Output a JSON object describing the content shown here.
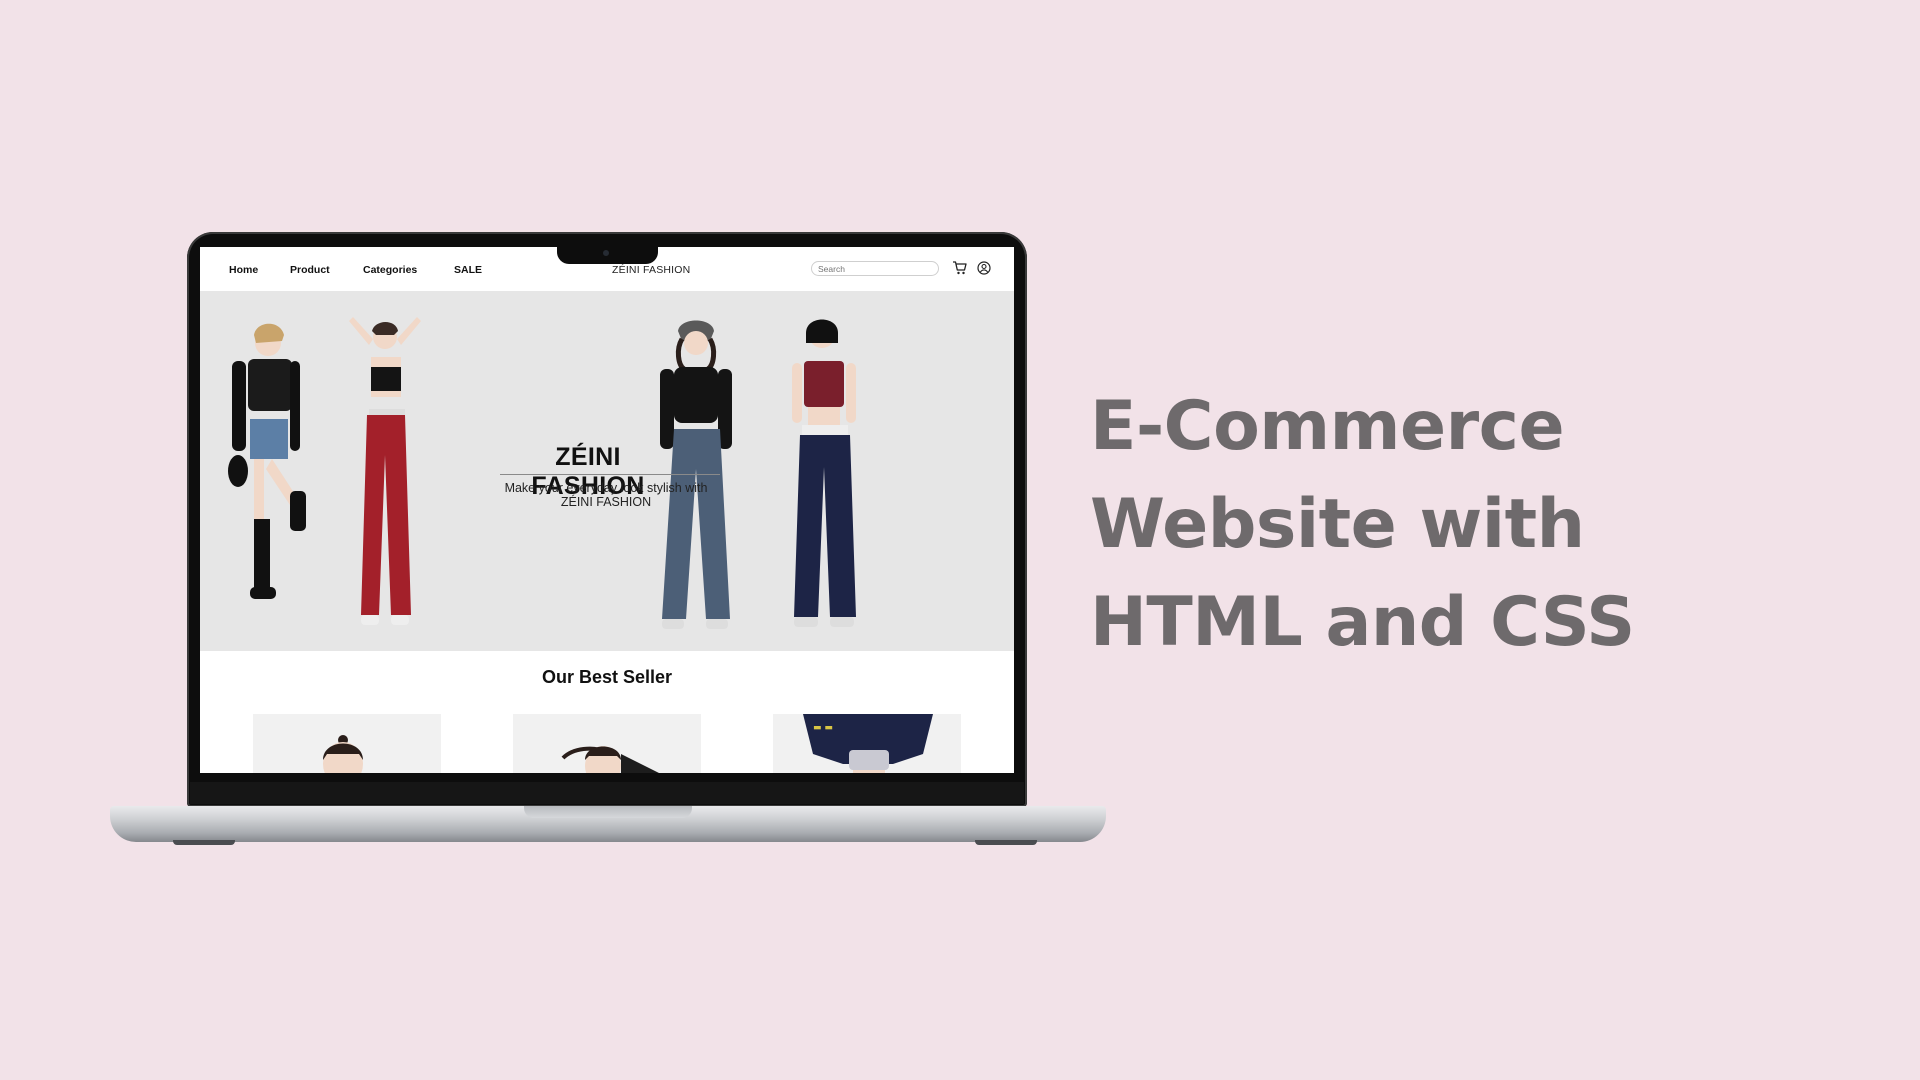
{
  "site": {
    "nav": {
      "home": "Home",
      "product": "Product",
      "categories": "Categories",
      "sale": "SALE",
      "brand": "ZÉINI FASHION",
      "search_placeholder": "Search"
    },
    "hero": {
      "title": "ZÉINI FASHION",
      "subtitle_line1": "Make your everyday look stylish with",
      "subtitle_line2": "ZÉINI FASHION"
    },
    "best_seller": {
      "title": "Our Best Seller"
    }
  },
  "headline": {
    "line1": "E-Commerce",
    "line2": "Website with",
    "line3": "HTML and CSS"
  },
  "icons": {
    "cart": "cart-icon",
    "account": "account-icon"
  },
  "colors": {
    "page_background": "#f2e2e8",
    "headline": "#6e6a6c",
    "hero_background": "#e6e6e6"
  }
}
